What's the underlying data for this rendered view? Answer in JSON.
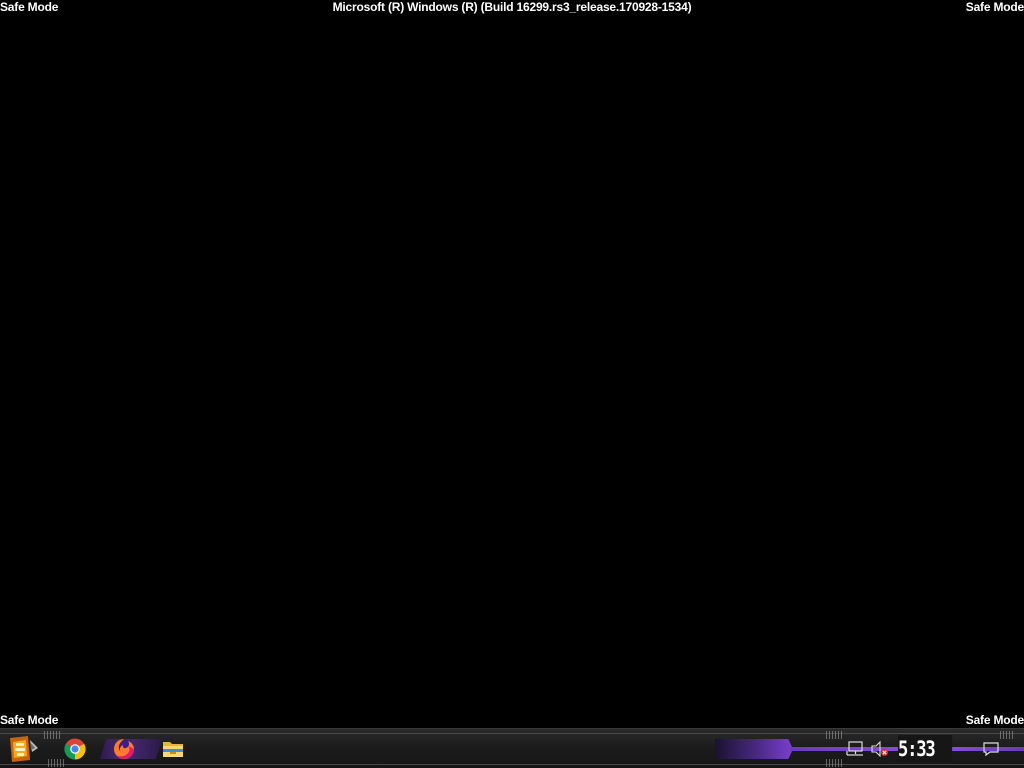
{
  "overlay": {
    "top_left": "Safe Mode",
    "top_center": "Microsoft (R) Windows (R) (Build 16299.rs3_release.170928-1534)",
    "top_right": "Safe Mode",
    "bottom_left": "Safe Mode",
    "bottom_right": "Safe Mode"
  },
  "taskbar": {
    "start_icon": "start-logo-icon",
    "pinned_apps": [
      {
        "name": "Google Chrome",
        "icon": "chrome-icon"
      },
      {
        "name": "Firefox",
        "icon": "firefox-icon"
      },
      {
        "name": "File Explorer",
        "icon": "folder-icon"
      }
    ],
    "tray": {
      "network_icon": "network-icon",
      "volume_icon": "volume-muted-icon",
      "clock": "5:33 PM",
      "notifications_icon": "action-center-icon"
    },
    "accent_color": "#7b3fd1"
  }
}
